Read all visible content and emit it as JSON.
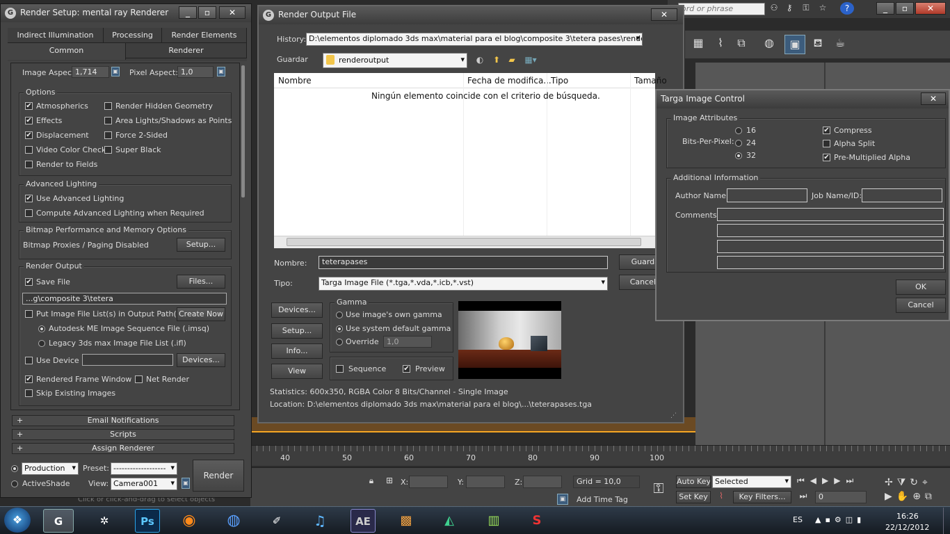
{
  "render_setup": {
    "title": "Render Setup: mental ray Renderer",
    "tabs_row1": [
      "Indirect Illumination",
      "Processing",
      "Render Elements"
    ],
    "tabs_row2": [
      "Common",
      "Renderer"
    ],
    "image_aspect_label": "Image Aspect:",
    "image_aspect_value": "1,714",
    "pixel_aspect_label": "Pixel Aspect:",
    "pixel_aspect_value": "1,0",
    "options_title": "Options",
    "options_left": [
      "Atmospherics",
      "Effects",
      "Displacement",
      "Video Color Check",
      "Render to Fields"
    ],
    "options_right": [
      "Render Hidden Geometry",
      "Area Lights/Shadows as Points",
      "Force 2-Sided",
      "Super Black"
    ],
    "adv_title": "Advanced Lighting",
    "adv_items": [
      "Use Advanced Lighting",
      "Compute Advanced Lighting when Required"
    ],
    "bitmap_title": "Bitmap Performance and Memory Options",
    "bitmap_text": "Bitmap Proxies / Paging Disabled",
    "setup_btn": "Setup...",
    "ro_title": "Render Output",
    "save_file": "Save File",
    "files_btn": "Files...",
    "output_path": "...g\\composite 3\\tetera",
    "put_image": "Put Image File List(s) in Output Path(s)",
    "create_now": "Create Now",
    "autodesk_seq": "Autodesk ME Image Sequence File (.imsq)",
    "legacy_list": "Legacy 3ds max Image File List (.ifl)",
    "use_device": "Use Device",
    "devices_btn": "Devices...",
    "rendered_frame": "Rendered Frame Window",
    "net_render": "Net Render",
    "skip_existing": "Skip Existing Images",
    "rollouts": [
      "Email Notifications",
      "Scripts",
      "Assign Renderer"
    ],
    "production": "Production",
    "preset_label": "Preset:",
    "preset_value": "-------------------",
    "activeshade": "ActiveShade",
    "view_label": "View:",
    "view_value": "Camera001",
    "render_btn": "Render"
  },
  "output_file": {
    "title": "Render Output File",
    "history_label": "History:",
    "history_value": "D:\\elementos diplomado 3ds max\\material para el blog\\composite 3\\tetera pases\\renderoutput",
    "guardar_label": "Guardar",
    "folder": "renderoutput",
    "columns": [
      "Nombre",
      "Fecha de modifica...",
      "Tipo",
      "Tamaño"
    ],
    "empty_msg": "Ningún elemento coincide con el criterio de búsqueda.",
    "nombre_label": "Nombre:",
    "nombre_value": "teterapases",
    "guardar_btn": "Guardar",
    "tipo_label": "Tipo:",
    "tipo_value": "Targa Image File (*.tga,*.vda,*.icb,*.vst)",
    "cancel_btn": "Cancelar",
    "side_buttons": [
      "Devices...",
      "Setup...",
      "Info...",
      "View"
    ],
    "gamma_title": "Gamma",
    "gamma_options": [
      "Use image's own gamma",
      "Use system default gamma",
      "Override"
    ],
    "override_value": "1,0",
    "sequence": "Sequence",
    "preview": "Preview",
    "statistics": "Statistics: 600x350, RGBA Color 8 Bits/Channel - Single Image",
    "location": "Location: D:\\elementos diplomado 3ds max\\material para el blog\\...\\teterapases.tga"
  },
  "targa": {
    "title": "Targa Image Control",
    "attr_title": "Image Attributes",
    "bpp_label": "Bits-Per-Pixel:",
    "bpp_options": [
      "16",
      "24",
      "32"
    ],
    "checks": [
      "Compress",
      "Alpha Split",
      "Pre-Multiplied Alpha"
    ],
    "info_title": "Additional Information",
    "author_label": "Author Name:",
    "job_label": "Job Name/ID:",
    "comments_label": "Comments:",
    "ok": "OK",
    "cancel": "Cancel"
  },
  "max_ui": {
    "search_placeholder": "ord or phrase",
    "ruler": [
      "40",
      "50",
      "60",
      "70",
      "80",
      "90",
      "100"
    ],
    "x_label": "X:",
    "y_label": "Y:",
    "z_label": "Z:",
    "grid": "Grid = 10,0",
    "auto_key": "Auto Key",
    "set_key": "Set Key",
    "selected": "Selected",
    "key_filters": "Key Filters...",
    "frame": "0",
    "add_time_tag": "Add Time Tag",
    "prompt": "Click or click-and-drag to select objects"
  },
  "taskbar": {
    "lang": "ES",
    "time": "16:26",
    "date": "22/12/2012",
    "apps": [
      "3ds",
      "Ps",
      "Ff",
      "Ae"
    ]
  },
  "colors": {
    "accent": "#f6a623",
    "panel": "#444444"
  }
}
